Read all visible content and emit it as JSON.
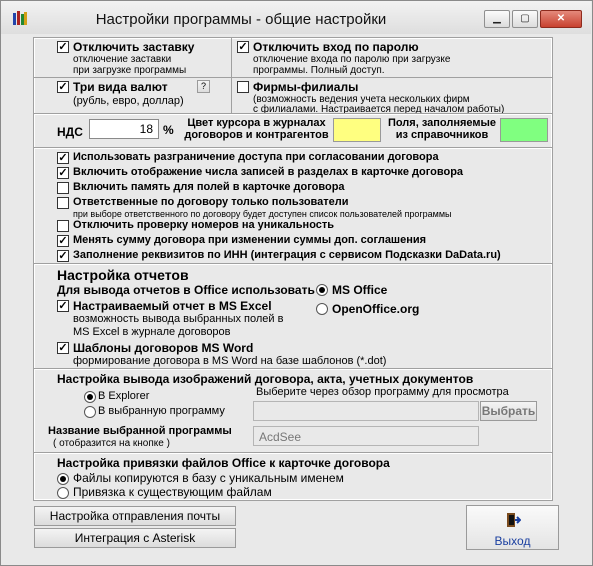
{
  "window": {
    "title": "Настройки программы - общие настройки",
    "min": "▁",
    "max": "▢",
    "close": "✕"
  },
  "top": {
    "disable_splash": {
      "label": "Отключить заставку",
      "desc1": "отключение заставки",
      "desc2": "при загрузке программы",
      "checked": true
    },
    "disable_login": {
      "label": "Отключить вход по паролю",
      "desc1": "отключение входа по паролю при загрузке",
      "desc2": "программы. Полный доступ.",
      "checked": true
    },
    "three_currencies": {
      "label": "Три вида валют",
      "desc": "(рубль, евро, доллар)",
      "checked": true
    },
    "branches": {
      "label": "Фирмы-филиалы",
      "desc1": "(возможность ведения учета нескольких фирм",
      "desc2": "с филиалами. Настраивается перед началом работы)",
      "checked": false
    },
    "help_glyph": "?"
  },
  "vat": {
    "label": "НДС",
    "value": "18",
    "unit": "%",
    "cursor_color_label1": "Цвет курсора в журналах",
    "cursor_color_label2": "договоров и контрагентов",
    "cursor_color": "#ffff80",
    "filled_label1": "Поля, заполняемые",
    "filled_label2": "из справочников",
    "filled_color": "#80ff80"
  },
  "options": [
    {
      "label": "Использовать разграничение доступа при согласовании договора",
      "checked": true
    },
    {
      "label": "Включить отображение числа записей в разделах в карточке договора",
      "checked": true
    },
    {
      "label": "Включить память для полей в карточке договора",
      "checked": false
    },
    {
      "label": "Ответственные по договору только пользователи",
      "desc": "при выборе ответственного по договору будет доступен  список пользователей программы",
      "checked": false
    },
    {
      "label": "Отключить проверку номеров на уникальность",
      "checked": false
    },
    {
      "label": "Менять сумму договора при изменении суммы доп. соглашения",
      "checked": true
    },
    {
      "label": "Заполнение реквизитов по ИНН (интеграция с сервисом Подсказки DaData.ru)",
      "checked": true
    }
  ],
  "reports": {
    "heading": "Настройка отчетов",
    "office_label": "Для вывода отчетов в Office использовать",
    "ms_office": "MS Office",
    "openoffice": "OpenOffice.org",
    "excel_label": "Настраиваемый отчет в MS Excel",
    "excel_desc1": "возможность вывода выбранных полей в",
    "excel_desc2": "MS Excel в журнале договоров",
    "word_label": "Шаблоны договоров MS Word",
    "word_desc": "формирование договора в MS Word на базе шаблонов (*.dot)"
  },
  "images": {
    "heading": "Настройка вывода изображений договора,  акта, учетных документов",
    "explorer": "В Explorer",
    "chosen": "В выбранную программу",
    "browse_hint": "Выберите через обзор программу для просмотра",
    "path_value": "",
    "choose_btn": "Выбрать",
    "name_label": "Название выбранной программы",
    "name_hint": "( отобразится на кнопке )",
    "name_value": "AcdSee"
  },
  "files": {
    "heading": "Настройка привязки файлов Office к карточке договора",
    "copy": "Файлы копируются в базу с уникальным именем",
    "link": "Привязка к существующим файлам"
  },
  "buttons": {
    "mail": "Настройка отправления почты",
    "asterisk": "Интеграция с Asterisk",
    "exit": "Выход"
  }
}
